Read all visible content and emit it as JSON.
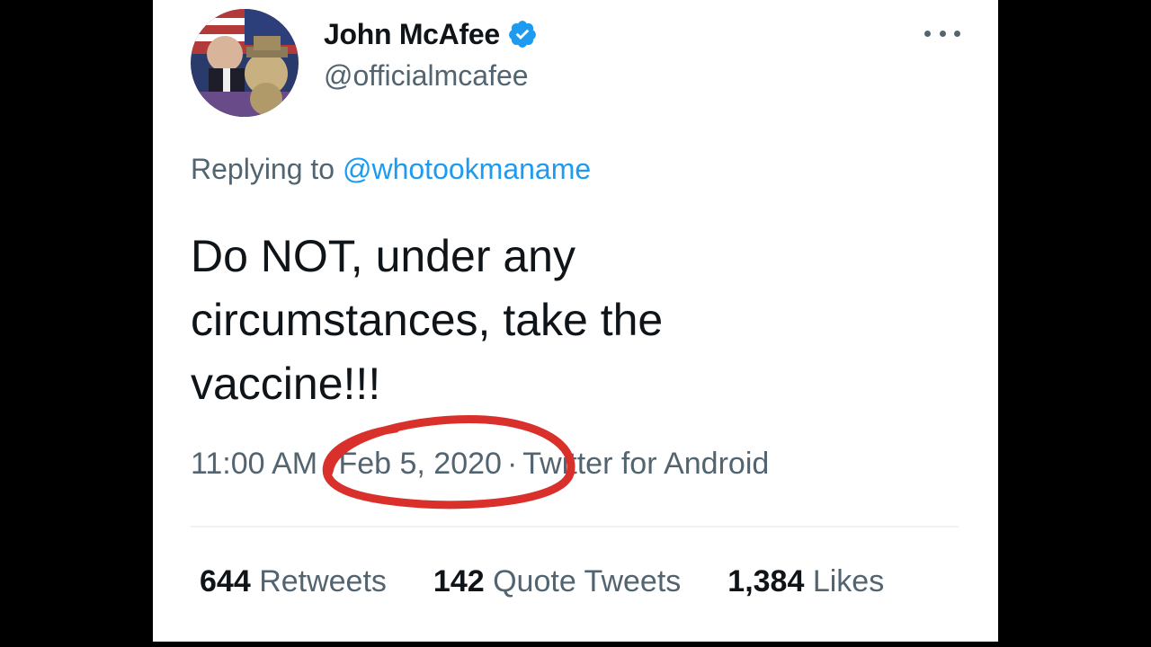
{
  "tweet": {
    "display_name": "John McAfee",
    "handle": "@officialmcafee",
    "verified_icon": "verified-badge-icon",
    "more_icon": "more-options-icon",
    "replying_prefix": "Replying to",
    "replying_to": "@whotookmaname",
    "text_lines": [
      "Do NOT, under any",
      "circumstances, take the",
      "vaccine!!!"
    ],
    "time": "11:00 AM",
    "date": "Feb 5, 2020",
    "source": "Twitter for Android",
    "separator": "·"
  },
  "stats": {
    "retweets_count": "644",
    "retweets_label": "Retweets",
    "quotes_count": "142",
    "quotes_label": "Quote Tweets",
    "likes_count": "1,384",
    "likes_label": "Likes"
  },
  "colors": {
    "background": "#000000",
    "card": "#ffffff",
    "text_primary": "#0f1419",
    "text_secondary": "#536471",
    "accent_blue": "#1d9bf0",
    "annotation_red": "#d9302c"
  }
}
